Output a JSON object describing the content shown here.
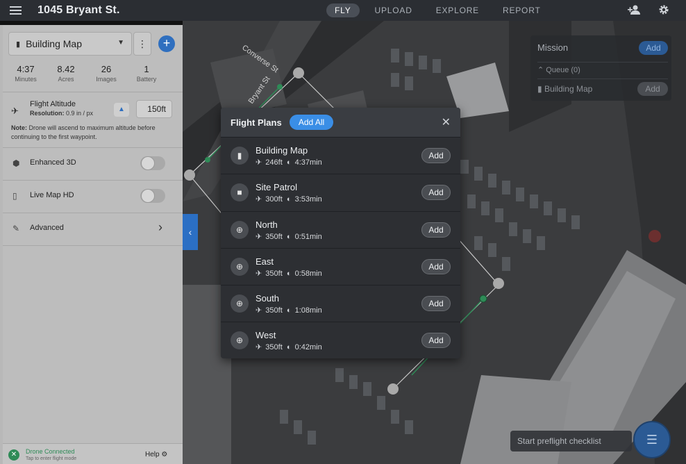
{
  "app": {
    "title": "1045 Bryant St."
  },
  "nav": {
    "tabs": [
      "FLY",
      "UPLOAD",
      "EXPLORE",
      "REPORT"
    ],
    "active": "FLY"
  },
  "topbar_icons": [
    "add-user-icon",
    "gear-icon"
  ],
  "sidebar": {
    "plan_select": {
      "value": "Building Map"
    },
    "stats": [
      {
        "value": "4:37",
        "label": "Minutes"
      },
      {
        "value": "8.42",
        "label": "Acres"
      },
      {
        "value": "26",
        "label": "Images"
      },
      {
        "value": "1",
        "label": "Battery"
      }
    ],
    "altitude": {
      "label": "Flight Altitude",
      "resolution_label": "Resolution:",
      "resolution_value": "0.9 in / px",
      "value": "150ft"
    },
    "note": {
      "label": "Note:",
      "text": "Drone will ascend to maximum altitude before continuing to the first waypoint."
    },
    "options": [
      {
        "label": "Enhanced 3D",
        "enabled": false
      },
      {
        "label": "Live Map HD",
        "enabled": false
      },
      {
        "label": "Advanced"
      }
    ],
    "status": {
      "title": "Drone Connected",
      "subtitle": "Tap to enter flight mode",
      "help": "Help"
    }
  },
  "mission": {
    "title": "Mission",
    "add_label": "Add",
    "queue_label": "Queue (0)",
    "item": {
      "label": "Building Map",
      "add_label": "Add"
    }
  },
  "preflight": {
    "label": "Start preflight checklist"
  },
  "modal": {
    "title": "Flight Plans",
    "add_all_label": "Add All",
    "close_glyph": "✕",
    "add_label": "Add",
    "plans": [
      {
        "name": "Building Map",
        "altitude": "246ft",
        "duration": "4:37min",
        "icon": "map-icon",
        "glyph": "▮"
      },
      {
        "name": "Site Patrol",
        "altitude": "300ft",
        "duration": "3:53min",
        "icon": "video-icon",
        "glyph": "■"
      },
      {
        "name": "North",
        "altitude": "350ft",
        "duration": "0:51min",
        "icon": "globe-icon",
        "glyph": "⊕"
      },
      {
        "name": "East",
        "altitude": "350ft",
        "duration": "0:58min",
        "icon": "globe-icon",
        "glyph": "⊕"
      },
      {
        "name": "South",
        "altitude": "350ft",
        "duration": "1:08min",
        "icon": "globe-icon",
        "glyph": "⊕"
      },
      {
        "name": "West",
        "altitude": "350ft",
        "duration": "0:42min",
        "icon": "globe-icon",
        "glyph": "⊕"
      }
    ]
  },
  "map": {
    "street_labels": [
      "Converse St",
      "Bryant St"
    ]
  }
}
